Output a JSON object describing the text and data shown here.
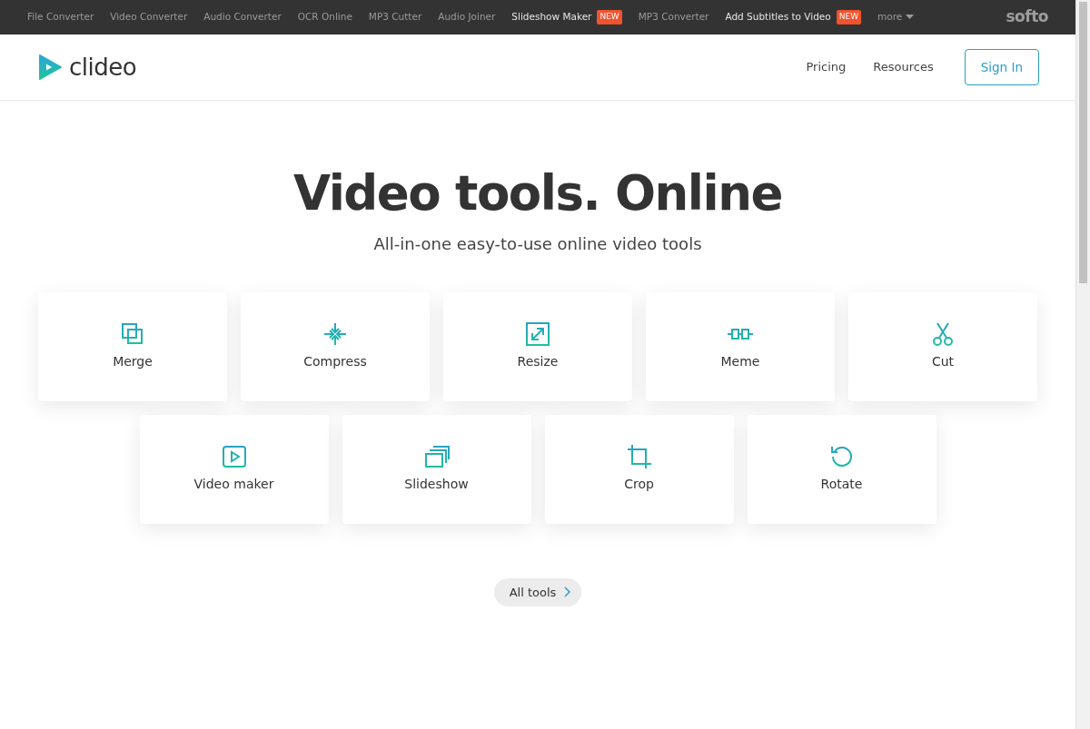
{
  "top_bar": {
    "items": [
      {
        "label": "File Converter",
        "highlighted": false
      },
      {
        "label": "Video Converter",
        "highlighted": false
      },
      {
        "label": "Audio Converter",
        "highlighted": false
      },
      {
        "label": "OCR Online",
        "highlighted": false
      },
      {
        "label": "MP3 Cutter",
        "highlighted": false
      },
      {
        "label": "Audio Joiner",
        "highlighted": false
      },
      {
        "label": "Slideshow Maker",
        "highlighted": true,
        "badge": "NEW"
      },
      {
        "label": "MP3 Converter",
        "highlighted": false
      },
      {
        "label": "Add Subtitles to Video",
        "highlighted": true,
        "badge": "NEW"
      }
    ],
    "more": "more",
    "brand": "softo"
  },
  "header": {
    "logo": "clideo",
    "nav": [
      "Pricing",
      "Resources"
    ],
    "sign_in": "Sign In"
  },
  "hero": {
    "title": "Video tools. Online",
    "subtitle": "All-in-one easy-to-use online video tools"
  },
  "tools": [
    {
      "label": "Merge"
    },
    {
      "label": "Compress"
    },
    {
      "label": "Resize"
    },
    {
      "label": "Meme"
    },
    {
      "label": "Cut"
    },
    {
      "label": "Video maker"
    },
    {
      "label": "Slideshow"
    },
    {
      "label": "Crop"
    },
    {
      "label": "Rotate"
    }
  ],
  "all_tools": "All tools"
}
